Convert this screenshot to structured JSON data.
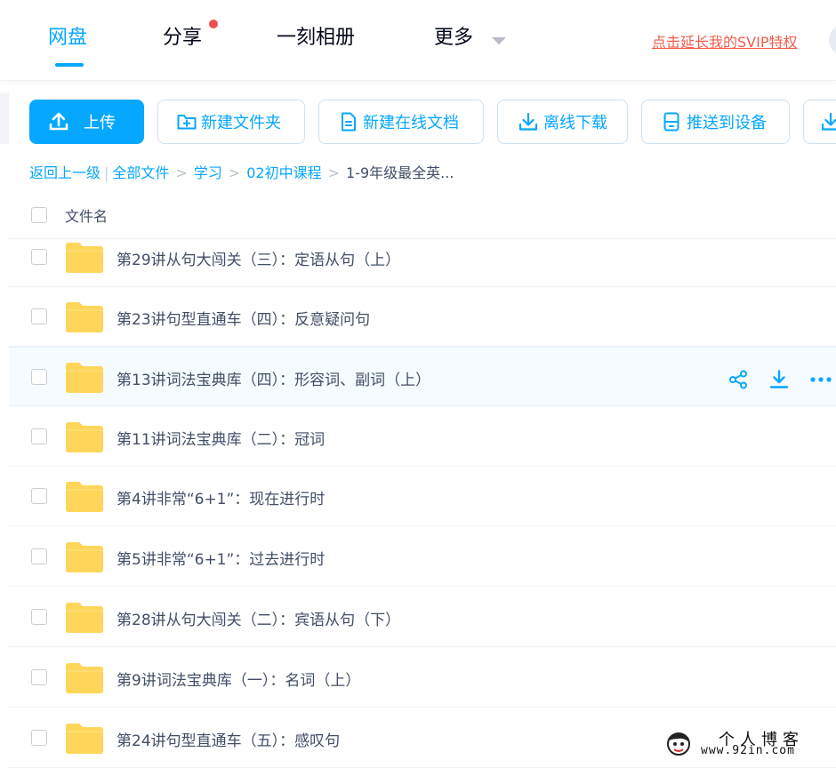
{
  "nav": {
    "tabs": [
      {
        "label": "网盘",
        "active": true
      },
      {
        "label": "分享",
        "badge": "red-dot"
      },
      {
        "label": "一刻相册"
      },
      {
        "label": "更多",
        "dropdown": true
      }
    ],
    "svip_link": "点击延长我的SVIP特权"
  },
  "toolbar": {
    "upload": "上传",
    "new_folder": "新建文件夹",
    "new_doc": "新建在线文档",
    "offline_download": "离线下载",
    "push_device": "推送到设备"
  },
  "breadcrumb": {
    "back": "返回上一级",
    "all_files": "全部文件",
    "level1": "学习",
    "level2": "02初中课程",
    "current": "1-9年级最全英..."
  },
  "list": {
    "column_name": "文件名",
    "rows": [
      {
        "name": "第29讲从句大闯关（三）：定语从句（上）"
      },
      {
        "name": "第23讲句型直通车（四）：反意疑问句"
      },
      {
        "name": "第13讲词法宝典库（四）：形容词、副词（上）",
        "hovered": true
      },
      {
        "name": "第11讲词法宝典库（二）：冠词"
      },
      {
        "name": "第4讲非常“6+1”：现在进行时"
      },
      {
        "name": "第5讲非常“6+1”：过去进行时"
      },
      {
        "name": "第28讲从句大闯关（二）：宾语从句（下）"
      },
      {
        "name": "第9讲词法宝典库（一）：名词（上）"
      },
      {
        "name": "第24讲句型直通车（五）：感叹句"
      }
    ]
  },
  "watermark": {
    "title": "个人博客",
    "url": "www.92in.com"
  },
  "colors": {
    "accent": "#06a7ff",
    "folder": "#ffd659",
    "svip": "#f25e4b",
    "text": "#424e67"
  }
}
